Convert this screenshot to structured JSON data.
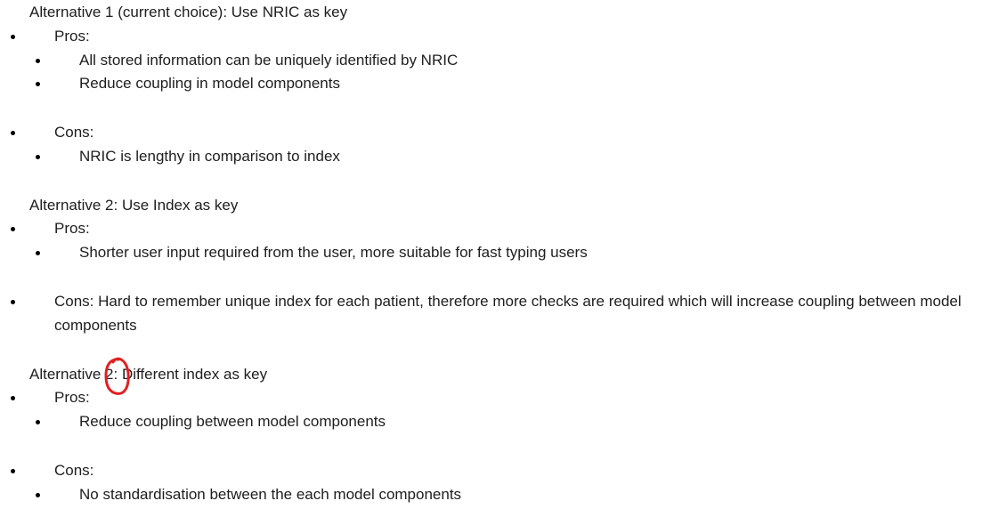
{
  "sections": [
    {
      "title": "Alternative 1 (current choice): Use NRIC as key",
      "pros_label": "Pros:",
      "pros": [
        "All stored information can be uniquely identified by NRIC",
        "Reduce coupling in model components"
      ],
      "cons_label": "Cons:",
      "cons": [
        "NRIC is lengthy in comparison to index"
      ]
    },
    {
      "title": "Alternative 2: Use Index as key",
      "pros_label": "Pros:",
      "pros": [
        "Shorter user input required from the user, more suitable for fast typing users"
      ],
      "cons_text": "Cons: Hard to remember unique index for each patient, therefore more checks are required which will increase coupling between model components"
    },
    {
      "title_prefix": "Alternative ",
      "title_number": "2:",
      "title_suffix": " Different index as key",
      "pros_label": "Pros:",
      "pros": [
        "Reduce coupling between model components"
      ],
      "cons_label": "Cons:",
      "cons": [
        "No standardisation between the each model components"
      ]
    }
  ],
  "annotation": {
    "type": "hand-drawn circle",
    "color": "#e02020"
  }
}
